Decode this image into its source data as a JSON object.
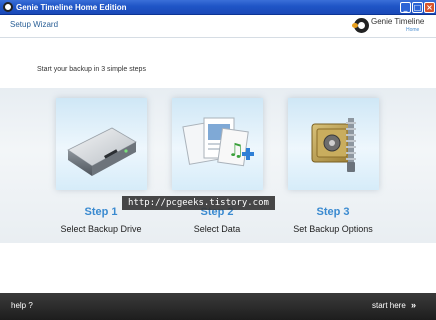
{
  "window": {
    "title": "Genie Timeline Home Edition",
    "buttons": {
      "minimize": "_",
      "maximize": "□",
      "close": "×"
    }
  },
  "header": {
    "wizard_title": "Setup Wizard",
    "logo": {
      "brand": "Genie Timeline",
      "edition": "Home"
    }
  },
  "intro": "Start your backup in 3 simple steps",
  "steps": [
    {
      "number": "Step 1",
      "label": "Select Backup Drive",
      "icon": "hard-drive-icon"
    },
    {
      "number": "Step 2",
      "label": "Select Data",
      "icon": "documents-music-add-icon"
    },
    {
      "number": "Step 3",
      "label": "Set Backup Options",
      "icon": "safe-zipper-icon"
    }
  ],
  "watermark": "http://pcgeeks.tistory.com",
  "footer": {
    "help": "help ?",
    "start": "start here",
    "start_arrows": "»"
  },
  "colors": {
    "accent": "#3a8ad0",
    "titlebar": "#1f55c6",
    "footer": "#2a2a2a"
  }
}
